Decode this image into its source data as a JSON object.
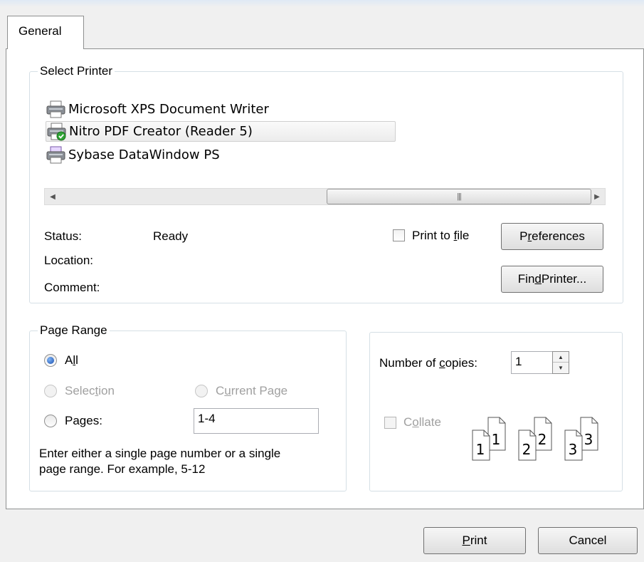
{
  "dialog": {
    "tab_label": "General"
  },
  "select_printer": {
    "legend": "Select Printer",
    "printers": [
      {
        "name": "Microsoft XPS Document Writer",
        "selected": false,
        "icon": "printer-icon"
      },
      {
        "name": "Nitro PDF Creator (Reader 5)",
        "selected": true,
        "icon": "default-printer-icon"
      },
      {
        "name": "Sybase DataWindow PS",
        "selected": false,
        "icon": "printer-icon"
      }
    ],
    "status_label": "Status:",
    "status_value": "Ready",
    "location_label": "Location:",
    "comment_label": "Comment:",
    "print_to_file": {
      "label_before": "Print to ",
      "mnemonic": "f",
      "label_after": "ile",
      "checked": false
    },
    "preferences": {
      "label_before": "P",
      "mnemonic": "r",
      "label_after": "eferences"
    },
    "find_printer": {
      "label_before": "Fin",
      "mnemonic": "d",
      "label_after": " Printer..."
    }
  },
  "page_range": {
    "legend": "Page Range",
    "all": {
      "label_before": "A",
      "mnemonic": "l",
      "label_after": "l",
      "checked": true
    },
    "selection": {
      "label_before": "Selec",
      "mnemonic": "t",
      "label_after": "ion",
      "enabled": false
    },
    "current_page": {
      "label_before": "C",
      "mnemonic": "u",
      "label_after": "rrent Page",
      "enabled": false
    },
    "pages": {
      "label_before": "Pa",
      "mnemonic": "g",
      "label_after": "es:",
      "value": "1-4"
    },
    "hint_line1": "Enter either a single page number or a single",
    "hint_line2": "page range.  For example, 5-12"
  },
  "copies": {
    "label_before": "Number of ",
    "mnemonic": "c",
    "label_after": "opies:",
    "value": "1",
    "collate": {
      "label_before": "C",
      "mnemonic": "o",
      "label_after": "llate",
      "checked": false,
      "enabled": false
    },
    "collate_pages": [
      {
        "back": "1",
        "front": "1"
      },
      {
        "back": "2",
        "front": "2"
      },
      {
        "back": "3",
        "front": "3"
      }
    ]
  },
  "footer": {
    "print": {
      "label_before": "",
      "mnemonic": "P",
      "label_after": "rint"
    },
    "cancel": {
      "label": "Cancel"
    }
  },
  "colors": {
    "panel_bg": "#ffffff",
    "dialog_bg": "#f0f0f0",
    "border": "#8e8f8f",
    "group_border": "#d5dfe5"
  }
}
